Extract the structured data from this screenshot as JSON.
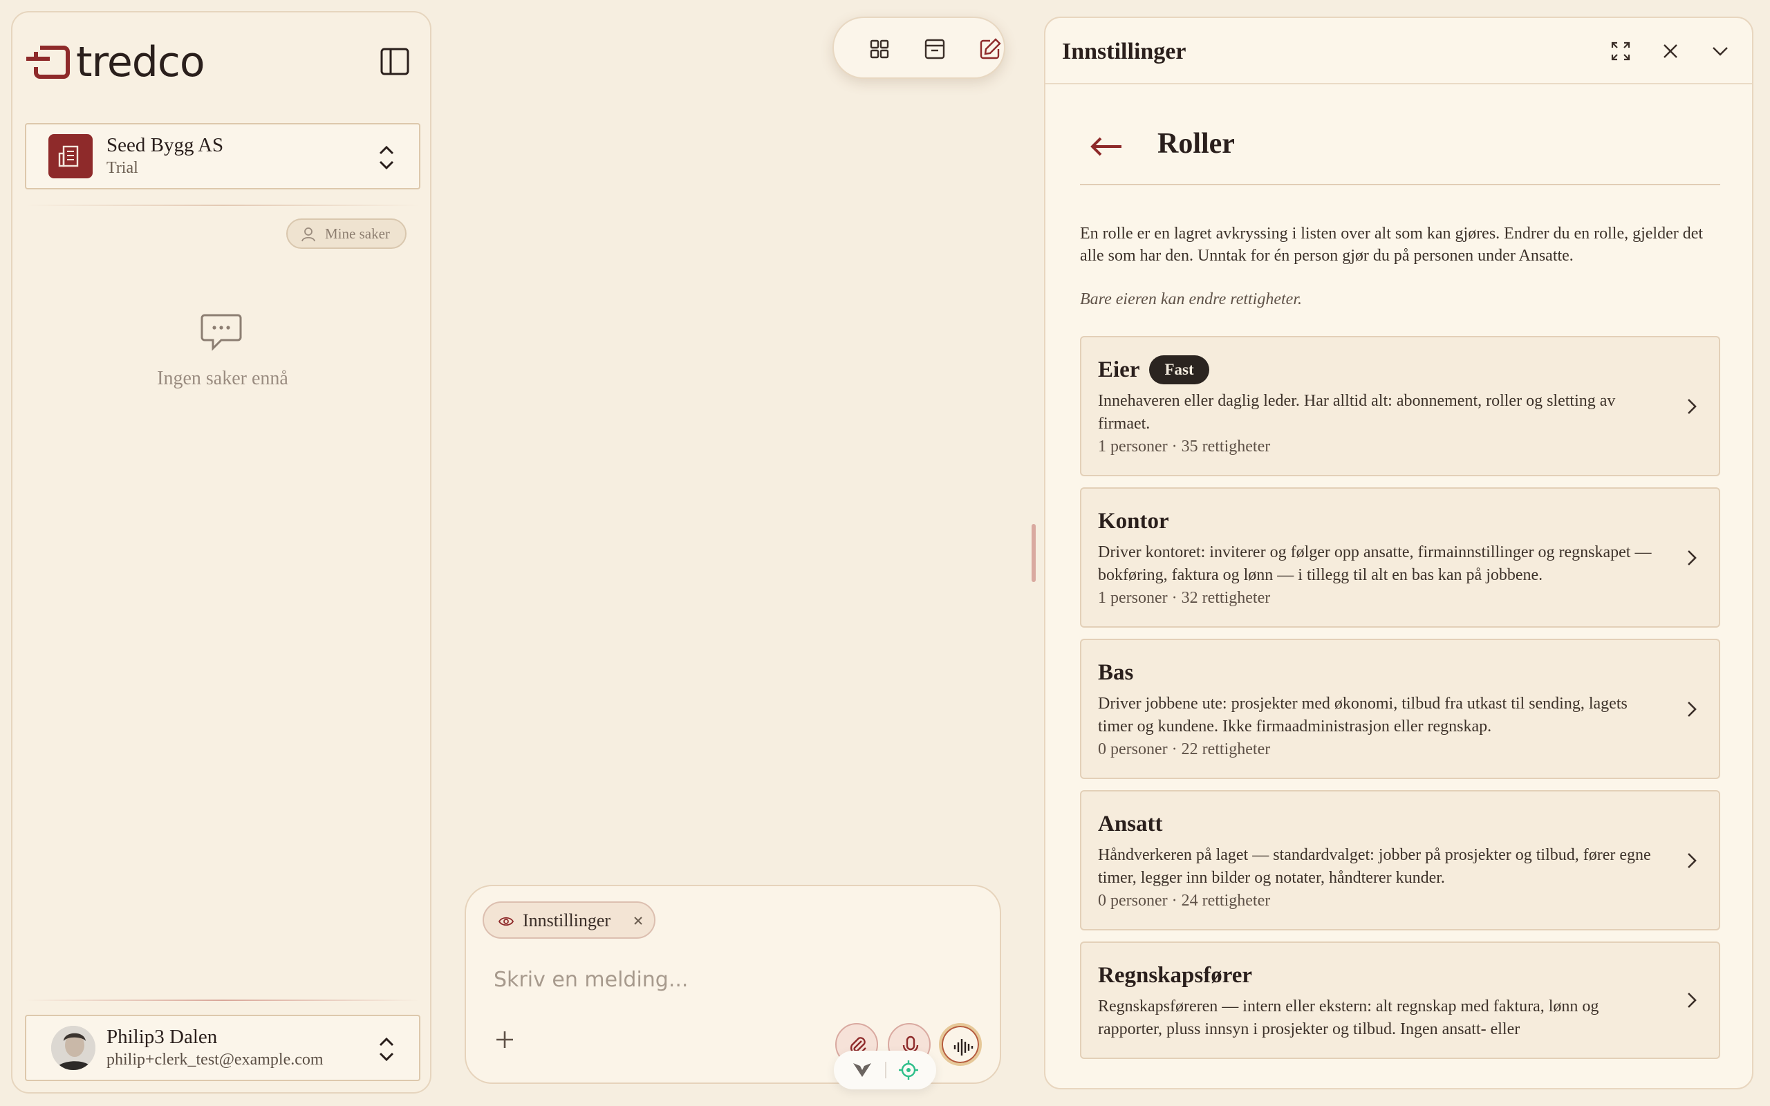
{
  "brand": {
    "name": "tredco",
    "accent": "#8e2a2a"
  },
  "sidebar": {
    "org": {
      "name": "Seed Bygg AS",
      "plan": "Trial",
      "icon": "building-icon"
    },
    "filter_label": "Mine saker",
    "empty_state": "Ingen saker ennå",
    "user": {
      "name": "Philip3 Dalen",
      "email": "philip+clerk_test@example.com"
    }
  },
  "toolbar": {
    "icons": [
      "grid-icon",
      "inbox-icon",
      "edit-icon"
    ]
  },
  "composer": {
    "context_chip": "Innstillinger",
    "placeholder": "Skriv en melding..."
  },
  "panel": {
    "title": "Innstillinger",
    "section_title": "Roller",
    "intro": "En rolle er en lagret avkryssing i listen over alt som kan gjøres. Endrer du en rolle, gjelder det alle som har den. Unntak for én person gjør du på personen under Ansatte.",
    "note": "Bare eieren kan endre rettigheter.",
    "roles": [
      {
        "name": "Eier",
        "badge": "Fast",
        "description": "Innehaveren eller daglig leder. Har alltid alt: abonnement, roller og sletting av firmaet.",
        "meta": "1 personer · 35 rettigheter"
      },
      {
        "name": "Kontor",
        "badge": "",
        "description": "Driver kontoret: inviterer og følger opp ansatte, firmainnstillinger og regnskapet — bokføring, faktura og lønn — i tillegg til alt en bas kan på jobbene.",
        "meta": "1 personer · 32 rettigheter"
      },
      {
        "name": "Bas",
        "badge": "",
        "description": "Driver jobbene ute: prosjekter med økonomi, tilbud fra utkast til sending, lagets timer og kundene. Ikke firmaadministrasjon eller regnskap.",
        "meta": "0 personer · 22 rettigheter"
      },
      {
        "name": "Ansatt",
        "badge": "",
        "description": "Håndverkeren på laget — standardvalget: jobber på prosjekter og tilbud, fører egne timer, legger inn bilder og notater, håndterer kunder.",
        "meta": "0 personer · 24 rettigheter"
      },
      {
        "name": "Regnskapsfører",
        "badge": "",
        "description": "Regnskapsføreren — intern eller ekstern: alt regnskap med faktura, lønn og rapporter, pluss innsyn i prosjekter og tilbud. Ingen ansatt- eller",
        "meta": ""
      }
    ]
  }
}
